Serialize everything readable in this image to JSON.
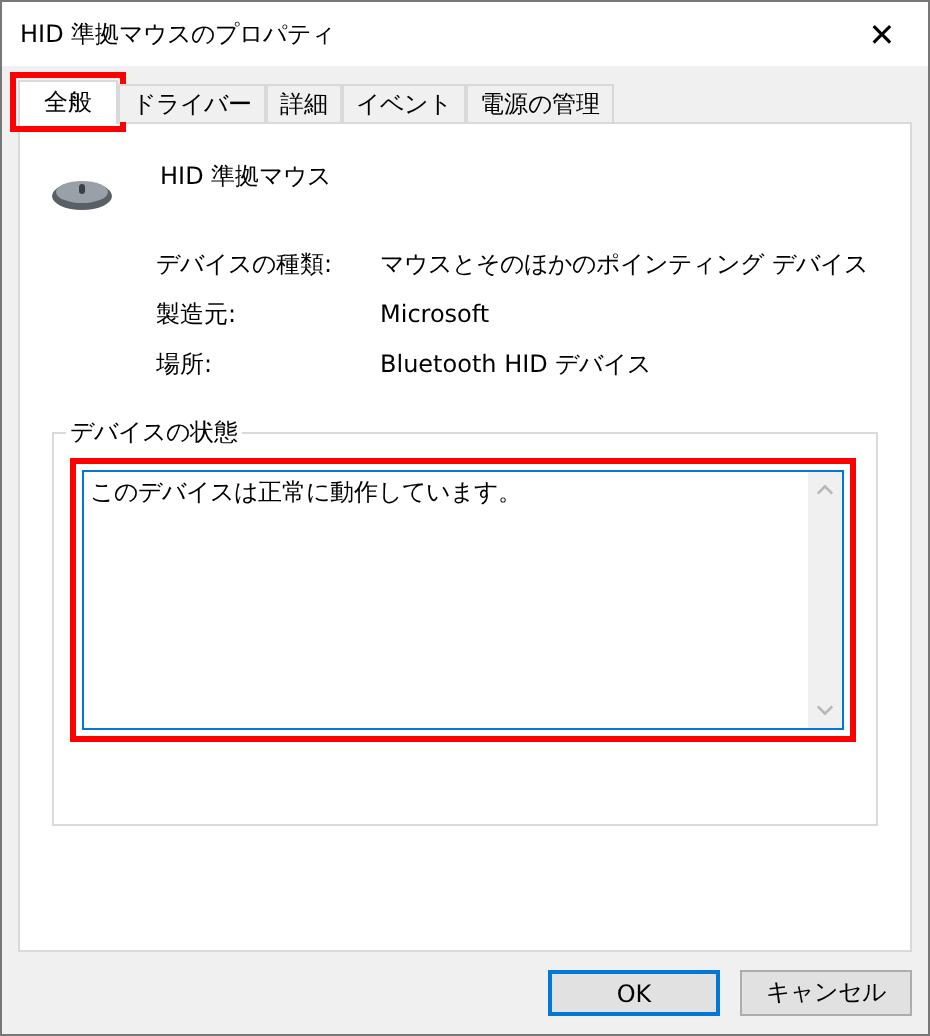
{
  "window": {
    "title": "HID 準拠マウスのプロパティ",
    "close": "✕"
  },
  "tabs": [
    {
      "label": "全般",
      "selected": true,
      "highlighted": true
    },
    {
      "label": "ドライバー",
      "selected": false,
      "highlighted": false
    },
    {
      "label": "詳細",
      "selected": false,
      "highlighted": false
    },
    {
      "label": "イベント",
      "selected": false,
      "highlighted": false
    },
    {
      "label": "電源の管理",
      "selected": false,
      "highlighted": false
    }
  ],
  "device": {
    "name": "HID 準拠マウス"
  },
  "properties": [
    {
      "label": "デバイスの種類:",
      "value": "マウスとそのほかのポインティング デバイス"
    },
    {
      "label": "製造元:",
      "value": "Microsoft"
    },
    {
      "label": "場所:",
      "value": "Bluetooth HID デバイス"
    }
  ],
  "status": {
    "title": "デバイスの状態",
    "text": "このデバイスは正常に動作しています。",
    "highlighted": true
  },
  "buttons": [
    {
      "label": "OK",
      "default": true
    },
    {
      "label": "キャンセル",
      "default": false
    }
  ]
}
